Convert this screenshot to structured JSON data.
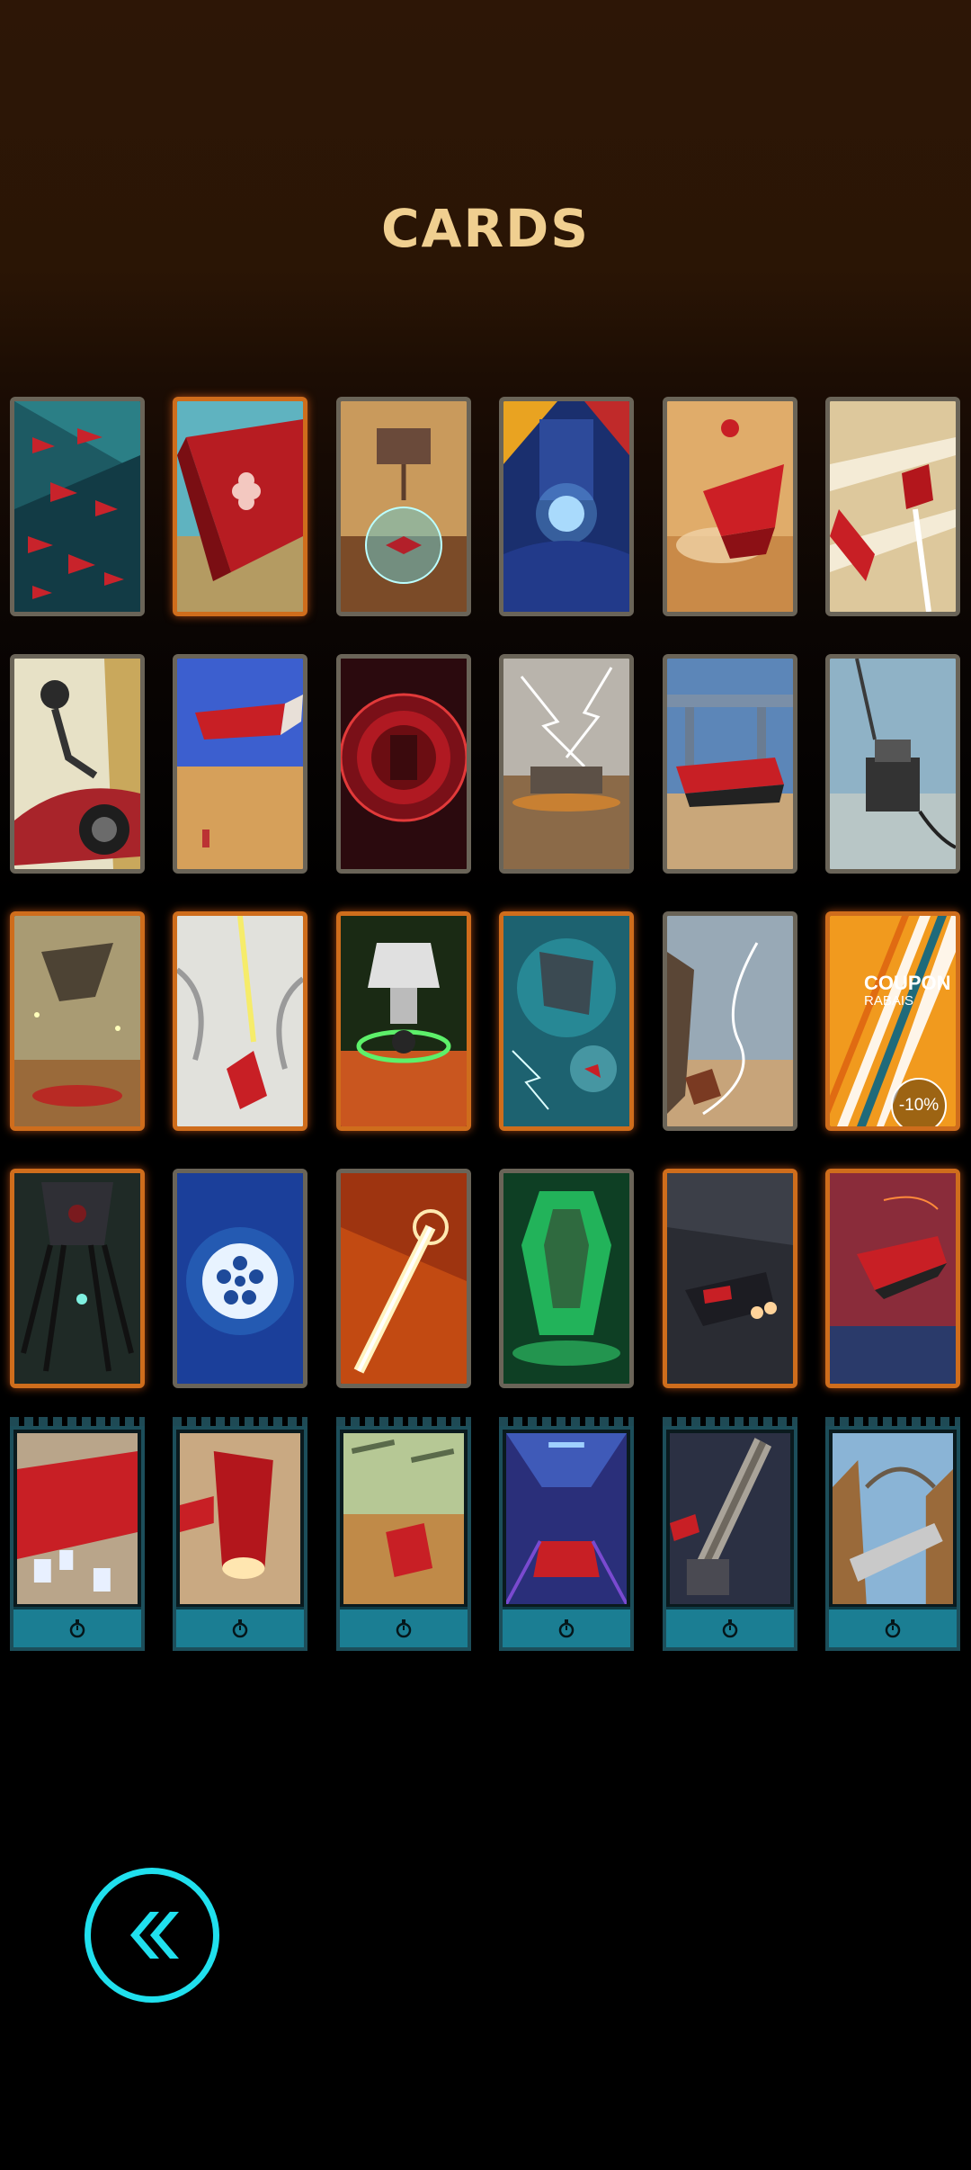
{
  "screen": {
    "title": "CARDS"
  },
  "cards": [
    {
      "id": "card-1-1",
      "frame": "gray",
      "theme": "red-ships-teal-grid"
    },
    {
      "id": "card-1-2",
      "frame": "orange",
      "theme": "red-hull-clover"
    },
    {
      "id": "card-1-3",
      "frame": "gray",
      "theme": "drone-shield-bubble"
    },
    {
      "id": "card-1-4",
      "frame": "gray",
      "theme": "blue-machine-energy"
    },
    {
      "id": "card-1-5",
      "frame": "gray",
      "theme": "red-ship-desert"
    },
    {
      "id": "card-1-6",
      "frame": "gray",
      "theme": "red-ship-light-streaks"
    },
    {
      "id": "card-2-1",
      "frame": "gray",
      "theme": "robot-arm-car"
    },
    {
      "id": "card-2-2",
      "frame": "gray",
      "theme": "red-ship-blue-sky"
    },
    {
      "id": "card-2-3",
      "frame": "gray",
      "theme": "red-vortex-core"
    },
    {
      "id": "card-2-4",
      "frame": "gray",
      "theme": "tank-lightning"
    },
    {
      "id": "card-2-5",
      "frame": "gray",
      "theme": "red-hover-car-bridge"
    },
    {
      "id": "card-2-6",
      "frame": "gray",
      "theme": "turret-station"
    },
    {
      "id": "card-3-1",
      "frame": "orange",
      "theme": "flying-fortress-desert"
    },
    {
      "id": "card-3-2",
      "frame": "orange",
      "theme": "ship-tentacles-beam"
    },
    {
      "id": "card-3-3",
      "frame": "orange",
      "theme": "mech-green-vortex"
    },
    {
      "id": "card-3-4",
      "frame": "orange",
      "theme": "mech-blue-storm"
    },
    {
      "id": "card-3-5",
      "frame": "gray",
      "theme": "crash-desert-trails"
    },
    {
      "id": "card-3-6",
      "frame": "orange",
      "theme": "coupon"
    },
    {
      "id": "card-4-1",
      "frame": "orange",
      "theme": "dark-spider-mech"
    },
    {
      "id": "card-4-2",
      "frame": "gray",
      "theme": "blue-hex-sphere"
    },
    {
      "id": "card-4-3",
      "frame": "gray",
      "theme": "orange-laser-beam"
    },
    {
      "id": "card-4-4",
      "frame": "gray",
      "theme": "green-crystal-core"
    },
    {
      "id": "card-4-5",
      "frame": "orange",
      "theme": "dark-mech-fighter"
    },
    {
      "id": "card-4-6",
      "frame": "orange",
      "theme": "red-ship-sunset-sea"
    }
  ],
  "coupon": {
    "line1": "COUPON",
    "line2": "RABAIS",
    "discount": "-10%"
  },
  "timed_cards": [
    {
      "id": "timed-1",
      "theme": "red-ship-cards"
    },
    {
      "id": "timed-2",
      "theme": "red-engine-ship"
    },
    {
      "id": "timed-3",
      "theme": "ship-canyon-green"
    },
    {
      "id": "timed-4",
      "theme": "neon-tunnel"
    },
    {
      "id": "timed-5",
      "theme": "gatling-gun"
    },
    {
      "id": "timed-6",
      "theme": "silver-rocket-canyon"
    }
  ],
  "icons": {
    "timer": "stopwatch-icon",
    "back": "double-chevron-left-icon"
  },
  "colors": {
    "title": "#f0cf90",
    "frame_gray": "#6a6458",
    "frame_orange": "#cf6d1c",
    "timed_bar": "#1b7e93",
    "back_ring": "#20e0ee"
  }
}
